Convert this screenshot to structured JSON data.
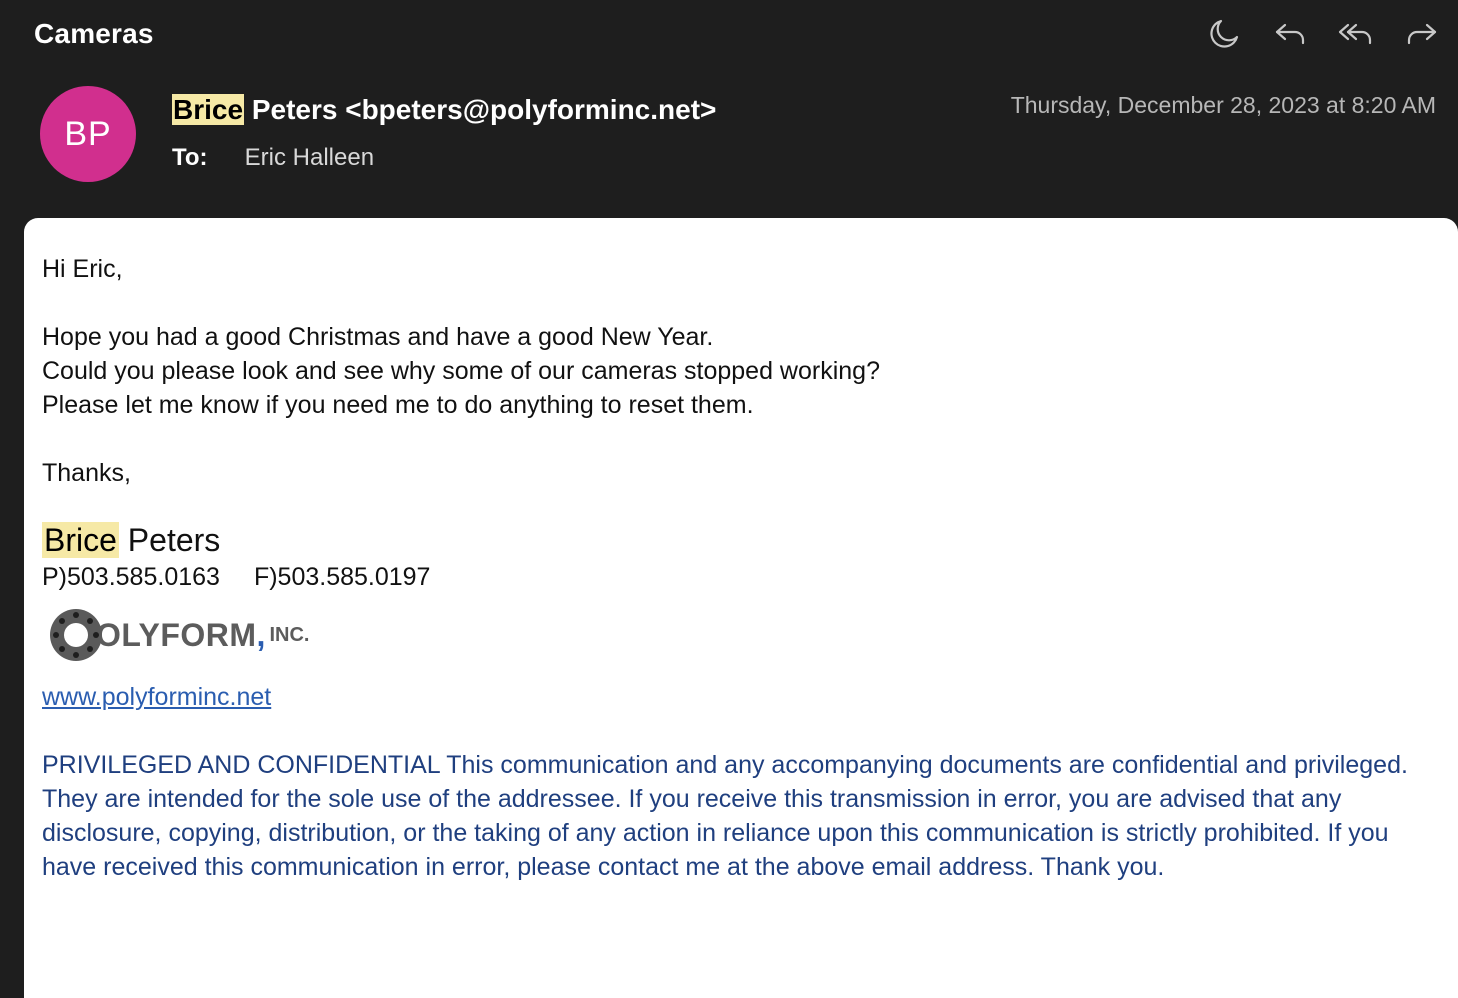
{
  "header": {
    "subject": "Cameras",
    "toolbar": [
      {
        "name": "snooze-icon"
      },
      {
        "name": "reply-icon"
      },
      {
        "name": "reply-all-icon"
      },
      {
        "name": "forward-icon"
      }
    ]
  },
  "message": {
    "avatar_initials": "BP",
    "avatar_color": "#d12f8e",
    "sender_first_highlighted": "Brice",
    "sender_rest": " Peters <bpeters@polyforminc.net>",
    "to_label": "To:",
    "to_value": "Eric Halleen",
    "date": "Thursday, December 28, 2023 at 8:20 AM",
    "highlight_color": "#f6e9a6"
  },
  "body": {
    "greeting": "Hi Eric,",
    "lines": [
      "Hope you had a good Christmas and have a good New Year.",
      "Could you please look and see why some of our cameras stopped working?",
      "Please let me know if you need me to do anything to reset them."
    ],
    "closing": "Thanks,",
    "signature": {
      "first_highlighted": "Brice",
      "last": " Peters",
      "phone": "P)503.585.0163",
      "fax": "F)503.585.0197",
      "logo_text": "OLYFORM",
      "logo_comma": ",",
      "logo_inc": "INC.",
      "website": "www.polyforminc.net"
    },
    "confidential": "PRIVILEGED AND CONFIDENTIAL This communication and any accompanying documents are confidential and privileged. They are intended for the sole use of the addressee. If you receive this transmission in error, you are advised that any disclosure, copying, distribution, or the taking of any action in reliance upon this communication is strictly prohibited. If you have received this communication in error, please contact me at the above email address. Thank you."
  }
}
